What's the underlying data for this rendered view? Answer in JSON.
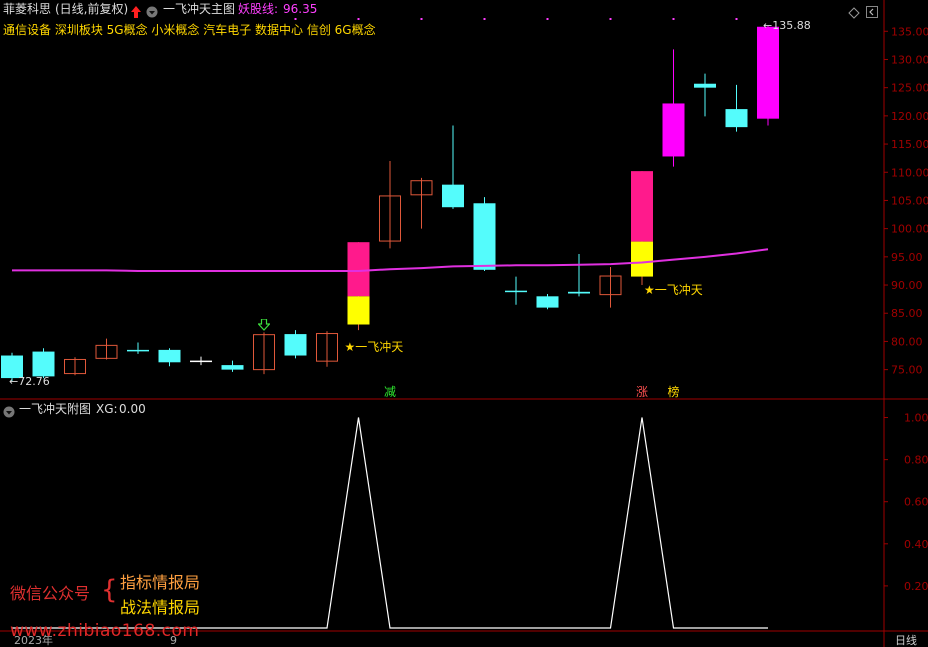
{
  "header": {
    "stock_name": "菲菱科思",
    "period_label": "(日线,前复权)",
    "main_indicator": "一飞冲天主图",
    "demon_line_label": "妖股线:",
    "demon_line_value": "96.35",
    "concepts": "通信设备 深圳板块 5G概念 小米概念 汽车电子 数据中心 信创 6G概念"
  },
  "sub_header": {
    "indicator_name": "一飞冲天附图",
    "xg_label": "XG:",
    "xg_value": "0.00"
  },
  "annotations": {
    "signal_label": "★一飞冲天",
    "high_label": "135.88",
    "low_label": "72.76",
    "badge_reduce": "减",
    "badge_limit_up": "涨",
    "badge_list": "榜"
  },
  "watermark": {
    "wechat": "微信公众号",
    "line1": "指标情报局",
    "line2": "战法情报局",
    "url": "www.zhibiao168.com"
  },
  "footer": {
    "year_label": "2023年",
    "month_label": "9",
    "period_button": "日线"
  },
  "colors": {
    "up_border": "#e0583a",
    "down_fill": "#54fcfc",
    "magenta": "#ff00ff",
    "signal_yellow": "#ffff00",
    "signal_pink": "#ff1a8c",
    "ma_line": "#e030e0",
    "axis_red": "#a00000",
    "label_yellow": "#ffd700"
  },
  "chart_data": [
    {
      "type": "candlestick",
      "ylim": [
        70.5,
        137
      ],
      "yticks": [
        75.0,
        80.0,
        85.0,
        90.0,
        95.0,
        100.0,
        105.0,
        110.0,
        115.0,
        120.0,
        125.0,
        130.0,
        135.0
      ],
      "candles": [
        {
          "o": 77.5,
          "c": 73.5,
          "h": 78.0,
          "l": 73.0,
          "style": "down"
        },
        {
          "o": 78.2,
          "c": 73.8,
          "h": 78.8,
          "l": 73.5,
          "style": "down"
        },
        {
          "o": 74.3,
          "c": 76.8,
          "h": 77.2,
          "l": 74.0,
          "style": "up"
        },
        {
          "o": 77.0,
          "c": 79.3,
          "h": 80.5,
          "l": 76.8,
          "style": "up"
        },
        {
          "o": 78.5,
          "c": 78.3,
          "h": 79.8,
          "l": 77.8,
          "style": "doji"
        },
        {
          "o": 78.5,
          "c": 76.3,
          "h": 78.8,
          "l": 75.6,
          "style": "down"
        },
        {
          "o": 76.6,
          "c": 76.4,
          "h": 77.3,
          "l": 75.8,
          "style": "doji"
        },
        {
          "o": 75.8,
          "c": 75.0,
          "h": 76.6,
          "l": 74.6,
          "style": "down"
        },
        {
          "o": 75.0,
          "c": 81.2,
          "h": 81.6,
          "l": 74.2,
          "style": "up"
        },
        {
          "o": 81.3,
          "c": 77.5,
          "h": 82.0,
          "l": 77.0,
          "style": "down"
        },
        {
          "o": 76.5,
          "c": 81.4,
          "h": 81.8,
          "l": 75.5,
          "style": "up"
        },
        {
          "o": 83.0,
          "c": 97.6,
          "h": 97.6,
          "l": 82.0,
          "style": "signal",
          "split": 88.0
        },
        {
          "o": 97.8,
          "c": 105.8,
          "h": 112.0,
          "l": 96.5,
          "style": "up"
        },
        {
          "o": 106.0,
          "c": 108.5,
          "h": 109.0,
          "l": 100.0,
          "style": "up"
        },
        {
          "o": 107.8,
          "c": 103.8,
          "h": 118.3,
          "l": 103.5,
          "style": "down"
        },
        {
          "o": 104.5,
          "c": 92.7,
          "h": 105.6,
          "l": 92.5,
          "style": "down"
        },
        {
          "o": 89.0,
          "c": 88.8,
          "h": 91.5,
          "l": 86.5,
          "style": "doji"
        },
        {
          "o": 88.0,
          "c": 86.0,
          "h": 88.4,
          "l": 85.7,
          "style": "down"
        },
        {
          "o": 88.8,
          "c": 88.5,
          "h": 95.5,
          "l": 88.0,
          "style": "down"
        },
        {
          "o": 88.3,
          "c": 91.6,
          "h": 93.2,
          "l": 86.0,
          "style": "up"
        },
        {
          "o": 91.5,
          "c": 110.2,
          "h": 110.2,
          "l": 90.0,
          "style": "signal",
          "split": 97.7
        },
        {
          "o": 112.8,
          "c": 122.2,
          "h": 131.8,
          "l": 111.0,
          "style": "magenta"
        },
        {
          "o": 125.7,
          "c": 125.0,
          "h": 127.5,
          "l": 119.9,
          "style": "down"
        },
        {
          "o": 121.2,
          "c": 118.0,
          "h": 125.5,
          "l": 117.2,
          "style": "down"
        },
        {
          "o": 119.5,
          "c": 135.8,
          "h": 136.0,
          "l": 118.3,
          "style": "magenta"
        }
      ],
      "demon_line": {
        "name": "妖股线",
        "values": [
          92.6,
          92.6,
          92.6,
          92.6,
          92.5,
          92.5,
          92.5,
          92.5,
          92.5,
          92.5,
          92.5,
          92.5,
          92.8,
          93.0,
          93.3,
          93.4,
          93.5,
          93.5,
          93.6,
          93.7,
          94.0,
          94.5,
          95.0,
          95.6,
          96.35
        ]
      },
      "signal_indices": [
        11,
        20
      ],
      "arrow_index": 8
    },
    {
      "type": "line",
      "series": [
        {
          "name": "XG",
          "values": [
            0,
            0,
            0,
            0,
            0,
            0,
            0,
            0,
            0,
            0,
            0,
            1,
            0,
            0,
            0,
            0,
            0,
            0,
            0,
            0,
            1,
            0,
            0,
            0,
            0
          ]
        }
      ],
      "ylim": [
        0,
        1.05
      ],
      "yticks": [
        0.2,
        0.4,
        0.6,
        0.8,
        1.0
      ]
    }
  ]
}
